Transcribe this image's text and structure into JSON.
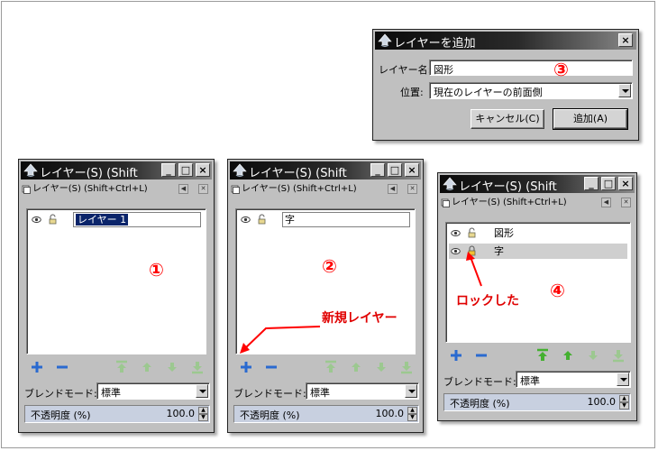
{
  "panel_title": "レイヤー(S) (Shift",
  "dock_label": "レイヤー(S) (Shift+Ctrl+L)",
  "panels": [
    {
      "annotation": "①",
      "layers": [
        {
          "name": "レイヤー 1",
          "editing": true,
          "selected": false,
          "locked": false
        }
      ]
    },
    {
      "annotation": "②",
      "layers": [
        {
          "name": "字",
          "editing": true,
          "selected": false,
          "locked": false
        }
      ]
    },
    {
      "annotation": "④",
      "layers": [
        {
          "name": "図形",
          "editing": false,
          "selected": false,
          "locked": false
        },
        {
          "name": "字",
          "editing": false,
          "selected": true,
          "locked": true
        }
      ]
    }
  ],
  "blend_mode_label": "ブレンドモード:",
  "blend_mode_value": "標準",
  "opacity_label": "不透明度 (%)",
  "opacity_value": "100.0",
  "annotations": {
    "new_layer": "新規レイヤー",
    "locked": "ロックした",
    "dialog_number": "③",
    "color": "#ff0000"
  },
  "dialog": {
    "title": "レイヤーを追加",
    "name_label": "レイヤー名:",
    "name_value": "図形",
    "position_label": "位置:",
    "position_value": "現在のレイヤーの前面側",
    "cancel_label": "キャンセル(C)",
    "add_label": "追加(A)"
  },
  "icons": {
    "app": "inkscape-logo-icon",
    "visibility": "eye-icon",
    "lock": "lock-icon",
    "add": "plus-icon",
    "remove": "minus-icon",
    "raise_top": "raise-to-top-icon",
    "raise": "raise-icon",
    "lower": "lower-icon",
    "lower_bottom": "lower-to-bottom-icon"
  },
  "colors": {
    "accent_green": "#44b030",
    "accent_blue": "#2a6ad0",
    "selection": "#0a246a"
  }
}
